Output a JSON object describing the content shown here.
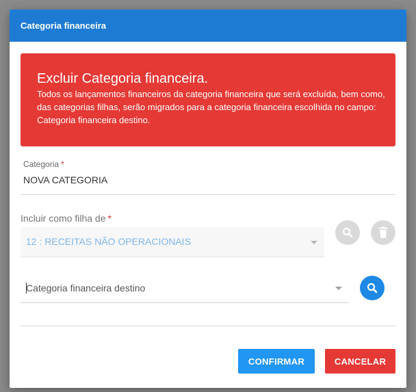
{
  "dialog": {
    "title": "Categoria financeira"
  },
  "alert": {
    "title": "Excluir Categoria financeira.",
    "message": "Todos os lançamentos financeiros da categoria financeira que será excluída, bem como, das categorias filhas, serão migrados para a categoria financeira escolhida no campo: Categoria financeira destino."
  },
  "form": {
    "categoria_label": "Categoria",
    "categoria_value": "NOVA CATEGORIA",
    "filha_label": "Incluir como filha de",
    "filha_value": "12 : RECEITAS NÃO OPERACIONAIS",
    "destino_placeholder": "Categoria financeira destino",
    "required_mark": "*"
  },
  "actions": {
    "confirm_label": "CONFIRMAR",
    "cancel_label": "CANCELAR"
  },
  "colors": {
    "header": "#1e7bd3",
    "alert": "#e53935",
    "confirm": "#2196f3",
    "cancel": "#e53935"
  },
  "icons": {
    "search": "magnifier-icon",
    "delete": "trash-icon"
  }
}
